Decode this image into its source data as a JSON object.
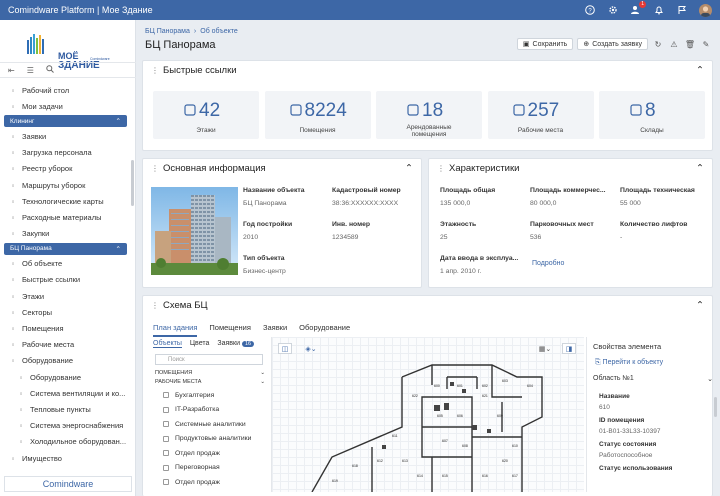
{
  "topbar": {
    "title": "Comindware Platform | Мое Здание",
    "notif_count": "1"
  },
  "logo": {
    "line1": "МОЁ",
    "line2": "ЗДАНИЕ",
    "small": "Comindware"
  },
  "sidebar": {
    "items_top": [
      "Рабочий стол",
      "Мои задачи"
    ],
    "group1": "Клининг",
    "group1_items": [
      "Заявки",
      "Загрузка персонала",
      "Реестр уборок",
      "Маршруты уборок",
      "Технологические карты",
      "Расходные материалы",
      "Закупки"
    ],
    "group2": "БЦ Панорама",
    "group2_items": [
      "Об объекте",
      "Быстрые ссылки",
      "Этажи",
      "Секторы",
      "Помещения",
      "Рабочие места",
      "Оборудование"
    ],
    "equipment_items": [
      "Оборудование",
      "Система вентиляции и ко...",
      "Тепловые пункты",
      "Система энергоснабжения",
      "Холодильное оборудован..."
    ],
    "last_item": "Имущество",
    "footer": "Comindware"
  },
  "header": {
    "crumb1": "БЦ Панорама",
    "crumb2": "Об объекте",
    "title": "БЦ Панорама",
    "save": "Сохранить",
    "create": "Создать заявку"
  },
  "quick": {
    "title": "Быстрые ссылки",
    "tiles": [
      {
        "num": "42",
        "label": "Этажи",
        "icon": "stairs-icon"
      },
      {
        "num": "8224",
        "label": "Помещения",
        "icon": "door-icon"
      },
      {
        "num": "18",
        "label": "Арендованные помещения",
        "icon": "check-circle-icon"
      },
      {
        "num": "257",
        "label": "Рабочие места",
        "icon": "chair-icon"
      },
      {
        "num": "8",
        "label": "Склады",
        "icon": "warehouse-icon"
      }
    ]
  },
  "info": {
    "title": "Основная информация",
    "fields": [
      {
        "label": "Название объекта",
        "value": "БЦ Панорама"
      },
      {
        "label": "Кадастровый номер",
        "value": "38:36:XXXXXX:XXXX"
      },
      {
        "label": "Год постройки",
        "value": "2010"
      },
      {
        "label": "Инв. номер",
        "value": "1234589"
      },
      {
        "label": "Тип объекта",
        "value": "Бизнес-центр"
      }
    ]
  },
  "chars": {
    "title": "Характеристики",
    "fields": [
      {
        "label": "Площадь общая",
        "value": "135 000,0"
      },
      {
        "label": "Площадь коммерчес...",
        "value": "80 000,0"
      },
      {
        "label": "Площадь техническая",
        "value": "55 000"
      },
      {
        "label": "Этажность",
        "value": "25"
      },
      {
        "label": "Парковочных мест",
        "value": "536"
      },
      {
        "label": "Количество лифтов",
        "value": "-"
      },
      {
        "label": "Дата ввода в эксплуа...",
        "value": "1 апр. 2010 г."
      }
    ],
    "more": "Подробно"
  },
  "schema": {
    "title": "Схема БЦ",
    "tabs": [
      "План здания",
      "Помещения",
      "Заявки",
      "Оборудование"
    ],
    "subtabs": [
      "Объекты",
      "Цвета",
      "Заявки"
    ],
    "subtab_count": "16",
    "search_placeholder": "Поиск",
    "sec1": "ПОМЕЩЕНИЯ",
    "sec2": "РАБОЧИЕ МЕСТА",
    "list": [
      "Бухгалтерия",
      "IT-Разработка",
      "Системные аналитики",
      "Продуктовые аналитики",
      "Отдел продаж",
      "Переговорная",
      "Отдел продаж"
    ],
    "props_title": "Свойства элемента",
    "goto": "Перейти к объекту",
    "area": "Область №1",
    "props": [
      {
        "label": "Название",
        "value": "610"
      },
      {
        "label": "ID помещения",
        "value": "01-В01-33L33-10397"
      },
      {
        "label": "Статус состояния",
        "value": "Работоспособное"
      },
      {
        "label": "Статус использования",
        "value": ""
      }
    ],
    "rooms": [
      "600",
      "601",
      "602",
      "603",
      "604",
      "605",
      "606",
      "607",
      "608",
      "609",
      "610",
      "611",
      "612",
      "613",
      "614",
      "615",
      "616",
      "617",
      "618",
      "619",
      "620",
      "621",
      "622"
    ]
  }
}
